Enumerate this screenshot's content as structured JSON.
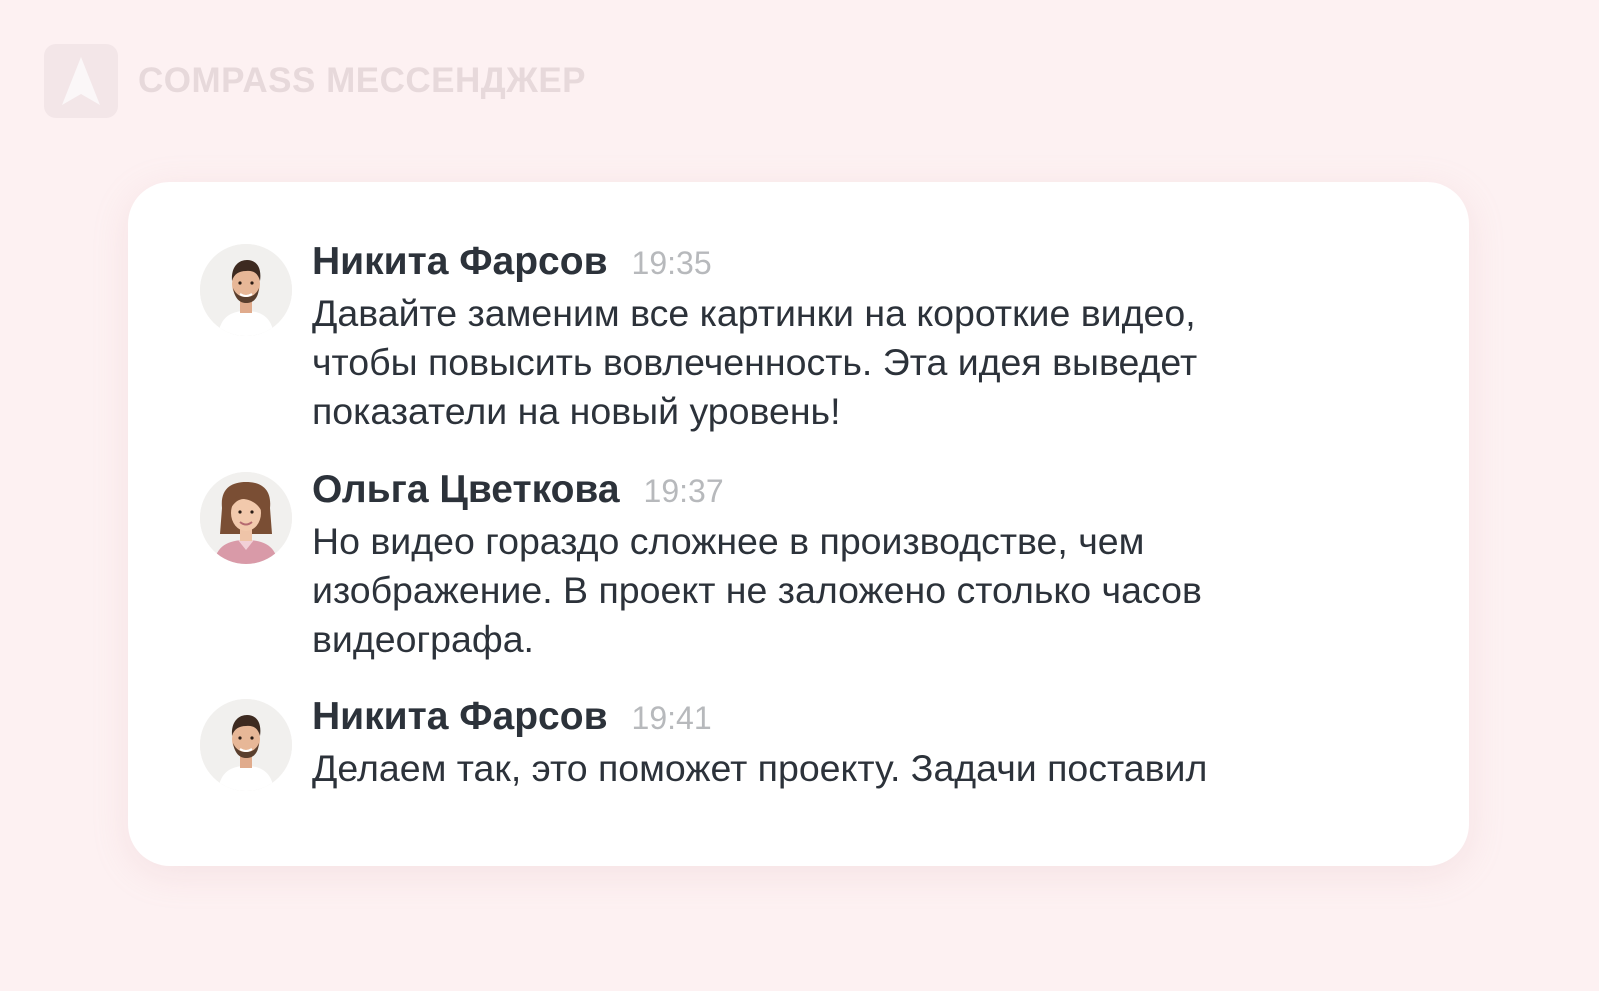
{
  "brand": {
    "name": "COMPASS МЕССЕНДЖЕР",
    "logo_icon": "compass-arrow-icon"
  },
  "colors": {
    "background": "#fdf1f2",
    "card": "#ffffff",
    "author_text": "#2c323a",
    "time_text": "#b7b9bc",
    "brand_text": "#e7d9db"
  },
  "messages": [
    {
      "author": "Никита Фарсов",
      "time": "19:35",
      "text": "Давайте заменим все картинки на короткие видео,\nчтобы повысить вовлеченность. Эта идея выведет\nпоказатели на новый уровень!",
      "avatar_icon": "man-avatar-icon"
    },
    {
      "author": "Ольга Цветкова",
      "time": "19:37",
      "text": "Но видео гораздо сложнее в производстве, чем\nизображение. В проект не заложено столько часов\nвидеографа.",
      "avatar_icon": "woman-avatar-icon"
    },
    {
      "author": "Никита Фарсов",
      "time": "19:41",
      "text": "Делаем так, это поможет проекту. Задачи поставил",
      "avatar_icon": "man-avatar-icon"
    }
  ]
}
